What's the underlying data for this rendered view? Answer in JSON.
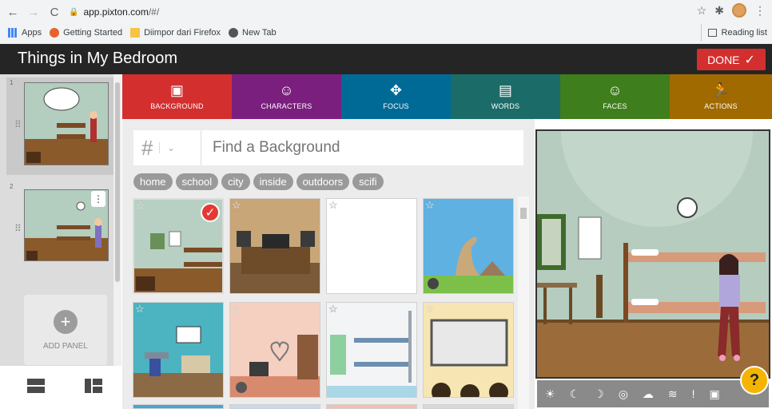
{
  "browser": {
    "url_host": "app.pixton.com",
    "url_path": "/#/",
    "bookmarks": [
      {
        "label": "Apps"
      },
      {
        "label": "Getting Started"
      },
      {
        "label": "Diimpor dari Firefox"
      },
      {
        "label": "New Tab"
      }
    ],
    "reading_list": "Reading list"
  },
  "app": {
    "title": "Things in My Bedroom",
    "done_label": "DONE"
  },
  "panels": [
    {
      "number": "1"
    },
    {
      "number": "2"
    }
  ],
  "add_panel_label": "ADD PANEL",
  "tabs": [
    {
      "label": "BACKGROUND",
      "color": "#d32f2f",
      "icon": "image-icon"
    },
    {
      "label": "CHARACTERS",
      "color": "#7b1f7e",
      "icon": "smiley-icon"
    },
    {
      "label": "FOCUS",
      "color": "#006a96",
      "icon": "move-icon"
    },
    {
      "label": "WORDS",
      "color": "#1b6c68",
      "icon": "speech-icon"
    },
    {
      "label": "FACES",
      "color": "#3f7e1c",
      "icon": "face-icon"
    },
    {
      "label": "ACTIONS",
      "color": "#a06a00",
      "icon": "running-icon"
    }
  ],
  "search": {
    "placeholder": "Find a Background",
    "hash": "#"
  },
  "tags": [
    "home",
    "school",
    "city",
    "inside",
    "outdoors",
    "scifi"
  ],
  "colors": {
    "header_bg": "#252525",
    "done_bg": "#d32f2f",
    "tag_bg": "#9a9a9a",
    "help_bg": "#f4b400"
  }
}
